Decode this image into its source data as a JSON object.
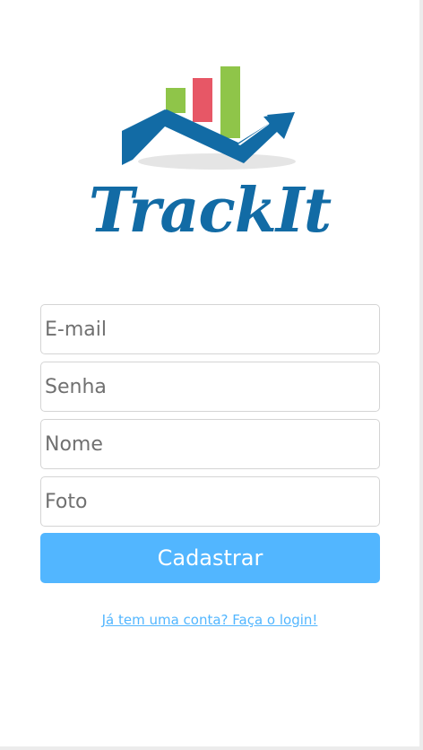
{
  "logo": {
    "name": "TrackIt",
    "icon": "chart-arrow-logo-icon",
    "colors": {
      "bar_left": "#8fc549",
      "bar_middle": "#e75766",
      "bar_right": "#8fc549",
      "arrow": "#126ba5",
      "shadow": "#e5e5e5"
    }
  },
  "form": {
    "email_placeholder": "E-mail",
    "password_placeholder": "Senha",
    "name_placeholder": "Nome",
    "photo_placeholder": "Foto",
    "submit_label": "Cadastrar"
  },
  "login_link": "Já tem uma conta? Faça o login!",
  "colors": {
    "brand": "#126ba5",
    "accent": "#52b6ff",
    "border": "#d4d4d4",
    "background": "#ffffff"
  }
}
